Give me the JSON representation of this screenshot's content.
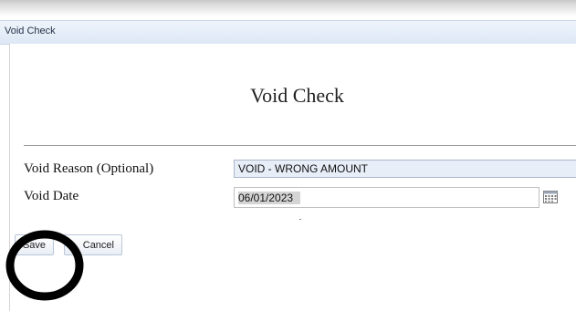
{
  "window": {
    "title": "Void Check"
  },
  "form": {
    "heading": "Void Check",
    "void_reason": {
      "label": "Void Reason (Optional)",
      "value": "VOID - WRONG AMOUNT"
    },
    "void_date": {
      "label": "Void Date",
      "value": "06/01/2023",
      "icon": "calendar-icon"
    }
  },
  "actions": {
    "save_label": "Save",
    "cancel_label": "Cancel"
  },
  "annotation": {
    "shape": "circle",
    "color": "#000000",
    "target": "save-button"
  }
}
